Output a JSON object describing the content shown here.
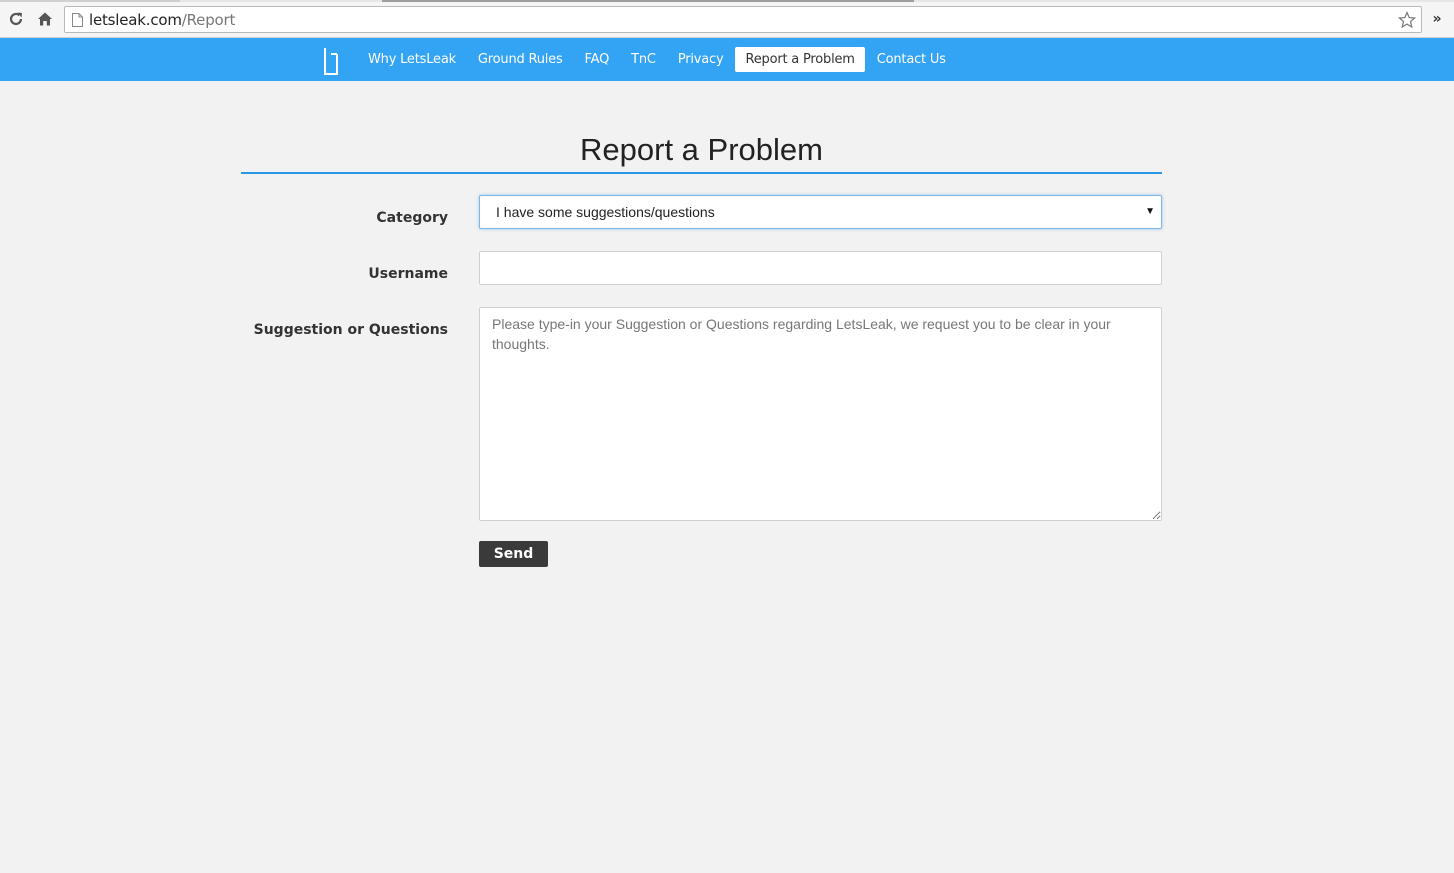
{
  "browser": {
    "url_host": "letsleak.com",
    "url_path": "/Report",
    "icons": [
      "reload-icon",
      "home-icon",
      "page-icon",
      "star-icon",
      "chevron-more-icon"
    ]
  },
  "nav": {
    "links": [
      {
        "label": "Why LetsLeak",
        "active": false
      },
      {
        "label": "Ground Rules",
        "active": false
      },
      {
        "label": "FAQ",
        "active": false
      },
      {
        "label": "TnC",
        "active": false
      },
      {
        "label": "Privacy",
        "active": false
      },
      {
        "label": "Report a Problem",
        "active": true
      },
      {
        "label": "Contact Us",
        "active": false
      }
    ]
  },
  "page": {
    "title": "Report a Problem"
  },
  "form": {
    "category_label": "Category",
    "category_value": "I have some suggestions/questions",
    "username_label": "Username",
    "username_value": "",
    "suggestion_label": "Suggestion or Questions",
    "suggestion_placeholder": "Please type-in your Suggestion or Questions regarding LetsLeak, we request you to be clear in your thoughts.",
    "send_label": "Send"
  },
  "colors": {
    "nav_bg": "#33a3f4",
    "title_rule": "#2996e6",
    "page_bg": "#f2f2f2",
    "send_bg": "#3a3a3a"
  }
}
